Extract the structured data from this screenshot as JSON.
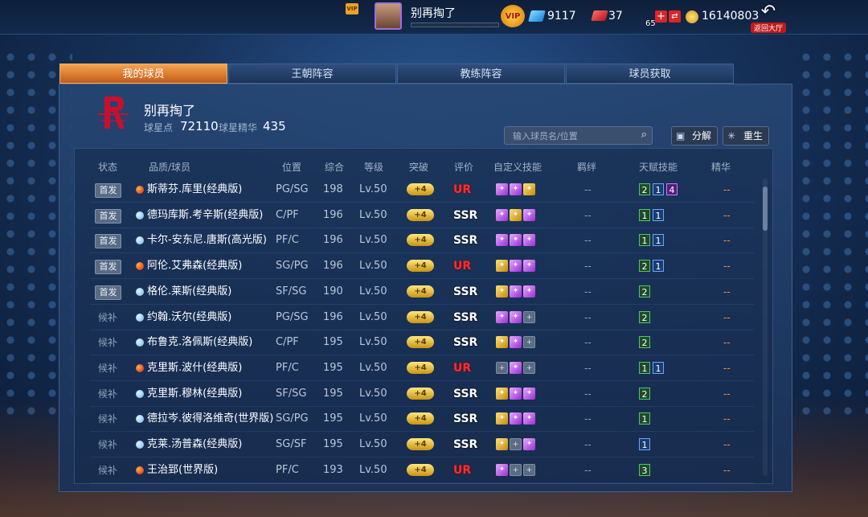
{
  "topbar": {
    "username": "别再掏了",
    "level": "65",
    "gems": "9117",
    "tickets": "37",
    "coins": "16140803",
    "back_label": "返回大厅",
    "vip_label": "VIP",
    "vip_small": "VIP"
  },
  "tabs": [
    {
      "label": "我的球员",
      "active": true
    },
    {
      "label": "王朝阵容",
      "active": false
    },
    {
      "label": "教练阵容",
      "active": false
    },
    {
      "label": "球员获取",
      "active": false
    }
  ],
  "team": {
    "name": "别再掏了",
    "star_points_label": "球星点",
    "star_points": "72110",
    "essence_label": "球星精华",
    "essence": "435"
  },
  "search": {
    "placeholder": "输入球员名/位置"
  },
  "buttons": {
    "decompose": "分解",
    "rebirth": "重生"
  },
  "table": {
    "headers": {
      "status": "状态",
      "player": "品质/球员",
      "position": "位置",
      "overall": "综合",
      "level": "等级",
      "breakthrough": "突破",
      "rating": "评价",
      "custom_skills": "自定义技能",
      "bonds": "羁绊",
      "talents": "天赋技能",
      "essence": "精华"
    },
    "rows": [
      {
        "status": "首发",
        "starter": true,
        "quality": "red",
        "name": "斯蒂芬.库里(经典版)",
        "position": "PG/SG",
        "overall": "198",
        "level": "Lv.50",
        "breakthrough": "+4",
        "rating": "UR",
        "skills": [
          "p",
          "p",
          "g"
        ],
        "bonds": "--",
        "talents": [
          {
            "v": "2",
            "c": "green"
          },
          {
            "v": "1",
            "c": "blue"
          },
          {
            "v": "4",
            "c": "purple"
          }
        ],
        "essence": "--"
      },
      {
        "status": "首发",
        "starter": true,
        "quality": "blue",
        "name": "德玛库斯.考辛斯(经典版)",
        "position": "C/PF",
        "overall": "196",
        "level": "Lv.50",
        "breakthrough": "+4",
        "rating": "SSR",
        "skills": [
          "p",
          "g",
          "p"
        ],
        "bonds": "--",
        "talents": [
          {
            "v": "1",
            "c": "green"
          },
          {
            "v": "1",
            "c": "blue"
          }
        ],
        "essence": "--"
      },
      {
        "status": "首发",
        "starter": true,
        "quality": "blue",
        "name": "卡尔-安东尼.唐斯(高光版)",
        "position": "PF/C",
        "overall": "196",
        "level": "Lv.50",
        "breakthrough": "+4",
        "rating": "SSR",
        "skills": [
          "p",
          "p",
          "p"
        ],
        "bonds": "--",
        "talents": [
          {
            "v": "1",
            "c": "green"
          },
          {
            "v": "1",
            "c": "blue"
          }
        ],
        "essence": "--"
      },
      {
        "status": "首发",
        "starter": true,
        "quality": "red",
        "name": "阿伦.艾弗森(经典版)",
        "position": "SG/PG",
        "overall": "196",
        "level": "Lv.50",
        "breakthrough": "+4",
        "rating": "UR",
        "skills": [
          "g",
          "p",
          "p"
        ],
        "bonds": "--",
        "talents": [
          {
            "v": "2",
            "c": "green"
          },
          {
            "v": "1",
            "c": "blue"
          }
        ],
        "essence": "--"
      },
      {
        "status": "首发",
        "starter": true,
        "quality": "blue",
        "name": "格伦.莱斯(经典版)",
        "position": "SF/SG",
        "overall": "190",
        "level": "Lv.50",
        "breakthrough": "+4",
        "rating": "SSR",
        "skills": [
          "g",
          "p",
          "p"
        ],
        "bonds": "--",
        "talents": [
          {
            "v": "2",
            "c": "green"
          }
        ],
        "essence": "--"
      },
      {
        "status": "候补",
        "starter": false,
        "quality": "blue",
        "name": "约翰.沃尔(经典版)",
        "position": "PG/SG",
        "overall": "196",
        "level": "Lv.50",
        "breakthrough": "+4",
        "rating": "SSR",
        "skills": [
          "p",
          "p",
          "e"
        ],
        "bonds": "--",
        "talents": [
          {
            "v": "2",
            "c": "green"
          }
        ],
        "essence": "--"
      },
      {
        "status": "候补",
        "starter": false,
        "quality": "blue",
        "name": "布鲁克.洛佩斯(经典版)",
        "position": "C/PF",
        "overall": "195",
        "level": "Lv.50",
        "breakthrough": "+4",
        "rating": "SSR",
        "skills": [
          "g",
          "p",
          "e"
        ],
        "bonds": "--",
        "talents": [
          {
            "v": "2",
            "c": "green"
          }
        ],
        "essence": "--"
      },
      {
        "status": "候补",
        "starter": false,
        "quality": "red",
        "name": "克里斯.波什(经典版)",
        "position": "PF/C",
        "overall": "195",
        "level": "Lv.50",
        "breakthrough": "+4",
        "rating": "UR",
        "skills": [
          "e",
          "p",
          "e"
        ],
        "bonds": "--",
        "talents": [
          {
            "v": "1",
            "c": "green"
          },
          {
            "v": "1",
            "c": "blue"
          }
        ],
        "essence": "--"
      },
      {
        "status": "候补",
        "starter": false,
        "quality": "blue",
        "name": "克里斯.穆林(经典版)",
        "position": "SF/SG",
        "overall": "195",
        "level": "Lv.50",
        "breakthrough": "+4",
        "rating": "SSR",
        "skills": [
          "g",
          "p",
          "p"
        ],
        "bonds": "--",
        "talents": [
          {
            "v": "2",
            "c": "green"
          }
        ],
        "essence": "--"
      },
      {
        "status": "候补",
        "starter": false,
        "quality": "blue",
        "name": "德拉岑.彼得洛维奇(世界版)",
        "position": "SG/PG",
        "overall": "195",
        "level": "Lv.50",
        "breakthrough": "+4",
        "rating": "SSR",
        "skills": [
          "g",
          "p",
          "p"
        ],
        "bonds": "--",
        "talents": [
          {
            "v": "1",
            "c": "green"
          }
        ],
        "essence": "--"
      },
      {
        "status": "候补",
        "starter": false,
        "quality": "blue",
        "name": "克莱.汤普森(经典版)",
        "position": "SG/SF",
        "overall": "195",
        "level": "Lv.50",
        "breakthrough": "+4",
        "rating": "SSR",
        "skills": [
          "g",
          "e",
          "p"
        ],
        "bonds": "--",
        "talents": [
          {
            "v": "1",
            "c": "blue"
          }
        ],
        "essence": "--"
      },
      {
        "status": "候补",
        "starter": false,
        "quality": "red",
        "name": "王治郅(世界版)",
        "position": "PF/C",
        "overall": "193",
        "level": "Lv.50",
        "breakthrough": "+4",
        "rating": "UR",
        "skills": [
          "p",
          "e",
          "e"
        ],
        "bonds": "--",
        "talents": [
          {
            "v": "3",
            "c": "green"
          }
        ],
        "essence": "--"
      }
    ]
  }
}
